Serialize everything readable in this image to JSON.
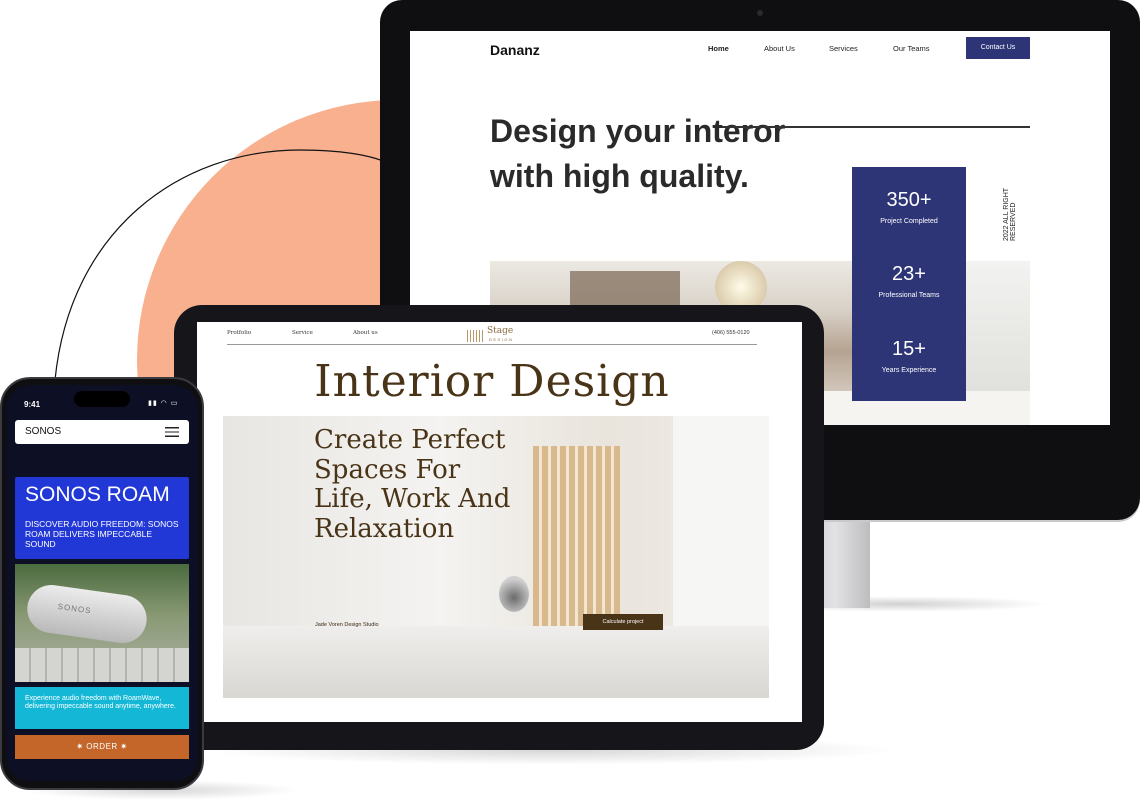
{
  "desktop": {
    "logo": "Dananz",
    "nav": {
      "home": "Home",
      "about": "About Us",
      "services": "Services",
      "teams": "Our Teams",
      "contact": "Contact Us"
    },
    "hero_title": "Design your interor with high quality.",
    "stats": [
      {
        "value": "350+",
        "label": "Project Completed"
      },
      {
        "value": "23+",
        "label": "Professional Teams"
      },
      {
        "value": "15+",
        "label": "Years Experience"
      }
    ],
    "side_text": "2022 ALL RIGHT RESERVED",
    "accent_color": "#2d3576"
  },
  "tablet": {
    "nav": {
      "portfolio": "Protfolio",
      "service": "Service",
      "about": "About us"
    },
    "logo_word": "Stage",
    "logo_sub": "DESIGN",
    "phone": "(406) 555-0120",
    "title": "Interior Design",
    "slogan": "Create Perfect Spaces For Life, Work And Relaxation",
    "studio": "Jade Voren Design Studio",
    "cta": "Calculate project",
    "accent_color": "#4a3417"
  },
  "phone": {
    "time": "9:41",
    "brand": "SONOS",
    "headline": "SONOS ROAM",
    "subheadline": "DISCOVER AUDIO FREEDOM: SONOS ROAM DELIVERS IMPECCABLE SOUND",
    "speaker_label": "SONOS",
    "body": "Experience audio freedom with RoamWave, delivering impeccable sound anytime, anywhere.",
    "order": "✷ ORDER ✷",
    "colors": {
      "blue": "#2238d6",
      "cyan": "#14b8d6",
      "order": "#c4662a"
    }
  }
}
